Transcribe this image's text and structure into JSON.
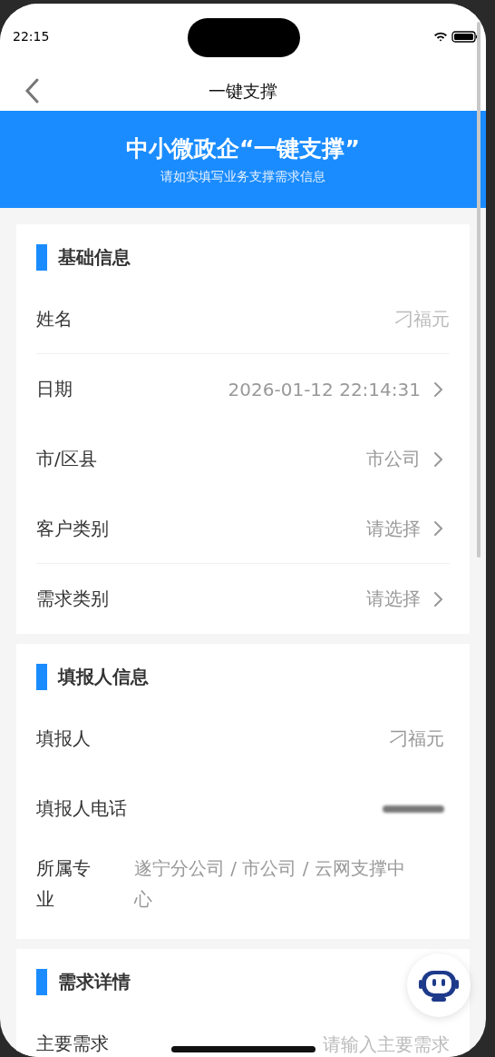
{
  "status_bar": {
    "time": "22:15"
  },
  "nav": {
    "title": "一键支撑"
  },
  "banner": {
    "title": "中小微政企“一键支撑”",
    "subtitle": "请如实填写业务支撑需求信息"
  },
  "sections": [
    {
      "title": "基础信息",
      "rows": [
        {
          "kind": "input",
          "label": "姓名",
          "value": "刁福元",
          "disabled": true,
          "divider": true
        },
        {
          "kind": "select",
          "label": "日期",
          "value": "2026-01-12 22:14:31",
          "divider": false
        },
        {
          "kind": "select",
          "label": "市/区县",
          "value": "市公司",
          "divider": false
        },
        {
          "kind": "select",
          "label": "客户类别",
          "value": "请选择",
          "divider": true
        },
        {
          "kind": "select",
          "label": "需求类别",
          "value": "请选择",
          "divider": false
        }
      ]
    },
    {
      "title": "填报人信息",
      "rows": [
        {
          "kind": "text",
          "label": "填报人",
          "value": "刁福元",
          "divider": false
        },
        {
          "kind": "redacted",
          "label": "填报人电话",
          "divider": false
        },
        {
          "kind": "wrap",
          "label": "所属专业",
          "value": "遂宁分公司 / 市公司 / 云网支撑中心",
          "divider": false
        }
      ]
    },
    {
      "title": "需求详情",
      "rows": [
        {
          "kind": "input",
          "label": "主要需求",
          "placeholder": "请输入主要需求",
          "divider": false
        }
      ]
    }
  ]
}
